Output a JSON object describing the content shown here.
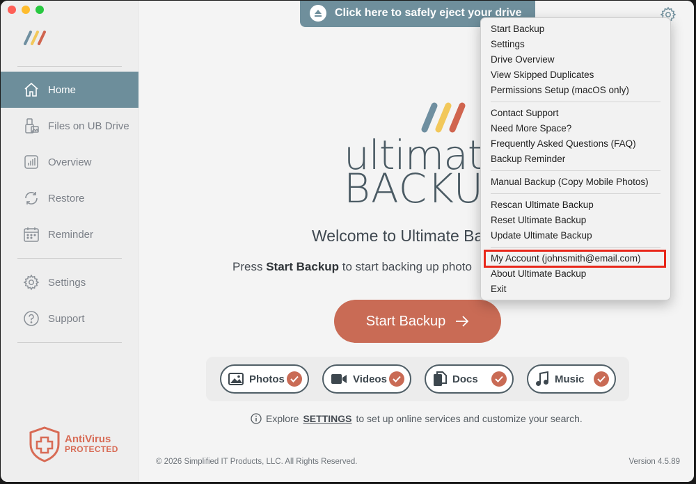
{
  "window": {
    "traffic_lights": [
      "close",
      "minimize",
      "zoom"
    ]
  },
  "sidebar": {
    "items": [
      {
        "label": "Home",
        "icon": "home-icon",
        "active": true
      },
      {
        "label": "Files on UB Drive",
        "icon": "drive-files-icon",
        "active": false
      },
      {
        "label": "Overview",
        "icon": "overview-chart-icon",
        "active": false
      },
      {
        "label": "Restore",
        "icon": "restore-icon",
        "active": false
      },
      {
        "label": "Reminder",
        "icon": "calendar-icon",
        "active": false
      },
      {
        "label": "Settings",
        "icon": "gear-icon",
        "active": false
      },
      {
        "label": "Support",
        "icon": "help-icon",
        "active": false
      }
    ],
    "antivirus": {
      "line1": "AntiVirus",
      "line2": "PROTECTED"
    }
  },
  "main": {
    "eject_banner": "Click here to safely eject your drive",
    "brand_line1": "ultimate",
    "brand_line2": "BACKUP",
    "welcome": "Welcome to Ultimate Ba",
    "press_prefix": "Press ",
    "press_bold": "Start Backup",
    "press_suffix": " to start backing up photo",
    "start_button": "Start Backup",
    "categories": [
      {
        "label": "Photos",
        "icon": "photo-icon",
        "checked": true
      },
      {
        "label": "Videos",
        "icon": "video-icon",
        "checked": true
      },
      {
        "label": "Docs",
        "icon": "docs-icon",
        "checked": true
      },
      {
        "label": "Music",
        "icon": "music-icon",
        "checked": true
      }
    ],
    "explore_prefix": "Explore ",
    "explore_link": "SETTINGS",
    "explore_suffix": " to set up online services and customize your search.",
    "copyright": "© 2026 Simplified IT Products, LLC. All Rights Reserved.",
    "version": "Version 4.5.89"
  },
  "menu": {
    "groups": [
      [
        "Start Backup",
        "Settings",
        "Drive Overview",
        "View Skipped Duplicates",
        "Permissions Setup (macOS only)"
      ],
      [
        "Contact Support",
        "Need More Space?",
        "Frequently Asked Questions (FAQ)",
        "Backup Reminder"
      ],
      [
        "Manual Backup (Copy Mobile Photos)"
      ],
      [
        "Rescan Ultimate Backup",
        "Reset Ultimate Backup",
        "Update Ultimate Backup"
      ],
      [
        "My Account (johnsmith@email.com)",
        "About Ultimate Backup",
        "Exit"
      ]
    ],
    "highlighted": "My Account (johnsmith@email.com)"
  },
  "colors": {
    "accent_teal": "#6d8e9b",
    "accent_orange": "#c96b55",
    "highlight_red": "#e8271a",
    "logo_blue": "#6f8fa0",
    "logo_yellow": "#f2c85b",
    "logo_orange": "#d0654f"
  }
}
